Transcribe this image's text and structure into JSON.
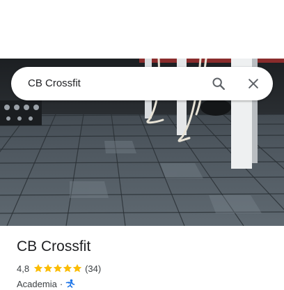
{
  "search": {
    "query": "CB Crossfit",
    "search_icon": "search-icon",
    "close_icon": "close-icon"
  },
  "place": {
    "name": "CB Crossfit",
    "rating": "4,8",
    "rating_value": 4.8,
    "rating_max": 5,
    "review_count": "(34)",
    "category": "Academia",
    "separator": "·",
    "category_icon": "gym-person-icon"
  },
  "colors": {
    "star": "#fbbc04",
    "accent": "#1a73e8",
    "text": "#202124",
    "secondary_text": "#3c4043"
  }
}
